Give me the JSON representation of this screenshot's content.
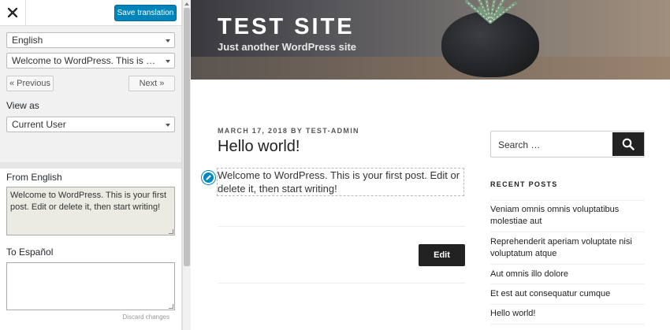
{
  "panel": {
    "save_label": "Save translation",
    "language": "English",
    "string": "Welcome to WordPress. This is your first post. Edit or delete it, then start writing!",
    "prev_label": "« Previous",
    "next_label": "Next »",
    "view_as_label": "View as",
    "view_as_value": "Current User",
    "from_label": "From English",
    "from_text": "Welcome to WordPress. This is your first post. Edit or delete it, then start writing!",
    "to_label": "To Español",
    "to_text": "",
    "discard_label": "Discard changes"
  },
  "site": {
    "title": "TEST SITE",
    "tagline": "Just another WordPress site",
    "post_meta_date": "MARCH 17, 2018",
    "post_meta_by": "BY",
    "post_meta_author": "TEST-ADMIN",
    "post_title": "Hello world!",
    "post_body": "Welcome to WordPress. This is your first post. Edit or delete it, then start writing!",
    "edit_label": "Edit",
    "search_placeholder": "Search …",
    "recent_posts_heading": "RECENT POSTS",
    "recent_posts": [
      "Veniam omnis omnis voluptatibus molestiae aut",
      "Reprehenderit aperiam voluptate nisi voluptatum atque",
      "Aut omnis illo dolore",
      "Et est aut consequatur cumque",
      "Hello world!"
    ]
  },
  "colors": {
    "accent": "#0085ba",
    "dark_button": "#222222"
  }
}
